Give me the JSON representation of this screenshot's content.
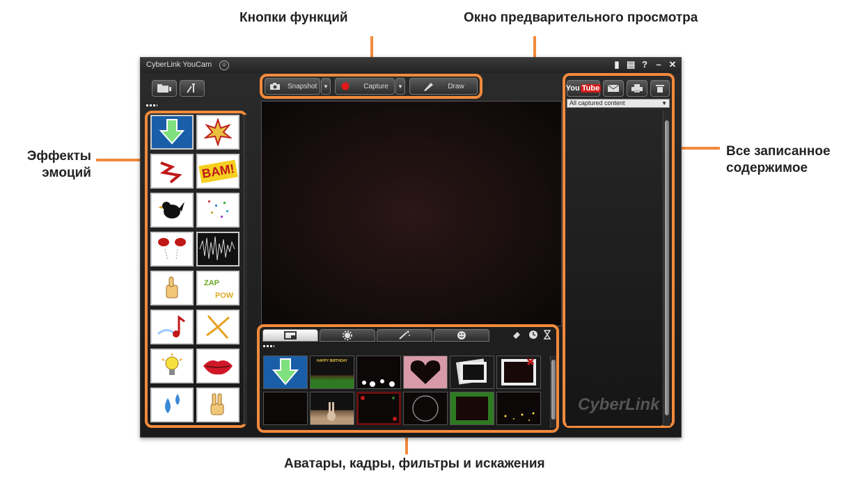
{
  "callouts": {
    "function_buttons": "Кнопки функций",
    "preview_window": "Окно предварительного просмотра",
    "emotion_effects_1": "Эффекты",
    "emotion_effects_2": "эмоций",
    "captured_content_1": "Все записанное",
    "captured_content_2": "содержимое",
    "avatars_frames": "Аватары, кадры, фильтры и искажения"
  },
  "app": {
    "title": "CyberLink YouCam",
    "title_badge": "®",
    "window_controls": [
      "▮",
      "▤",
      "?",
      "–",
      "✕"
    ],
    "toolbar": {
      "snapshot": "Snapshot",
      "capture": "Capture",
      "draw": "Draw",
      "dropdown_arrow": "▼"
    },
    "right_panel": {
      "youtube_you": "You",
      "youtube_tube": "Tube",
      "filter_select": "All captured content",
      "brand_watermark": "CyberLink"
    },
    "effects_icons": [
      "download-arrow",
      "explosion",
      "zigzag",
      "bam",
      "bird",
      "confetti",
      "gloves",
      "soundwave",
      "thumbs-up",
      "text-burst",
      "music-note",
      "sparks",
      "lightbulb",
      "lips",
      "water-drops",
      "peace-hand"
    ],
    "bottom_tabs": [
      "avatars",
      "frames",
      "filters",
      "emotions"
    ],
    "frames": [
      "download-arrow",
      "happy-birthday",
      "bubbles",
      "heart",
      "photo-stack",
      "gift-ribbon",
      "dark-blank",
      "bunny",
      "rose-border",
      "circle",
      "green-frame",
      "sparkle-stars"
    ],
    "frame_label_birthday": "HAPPY BIRTHDAY",
    "effect_label_bam": "BAM!"
  },
  "colors": {
    "accent": "#f28a3c",
    "app_bg": "#1e1e1e",
    "youtube_red": "#d31c1c"
  }
}
